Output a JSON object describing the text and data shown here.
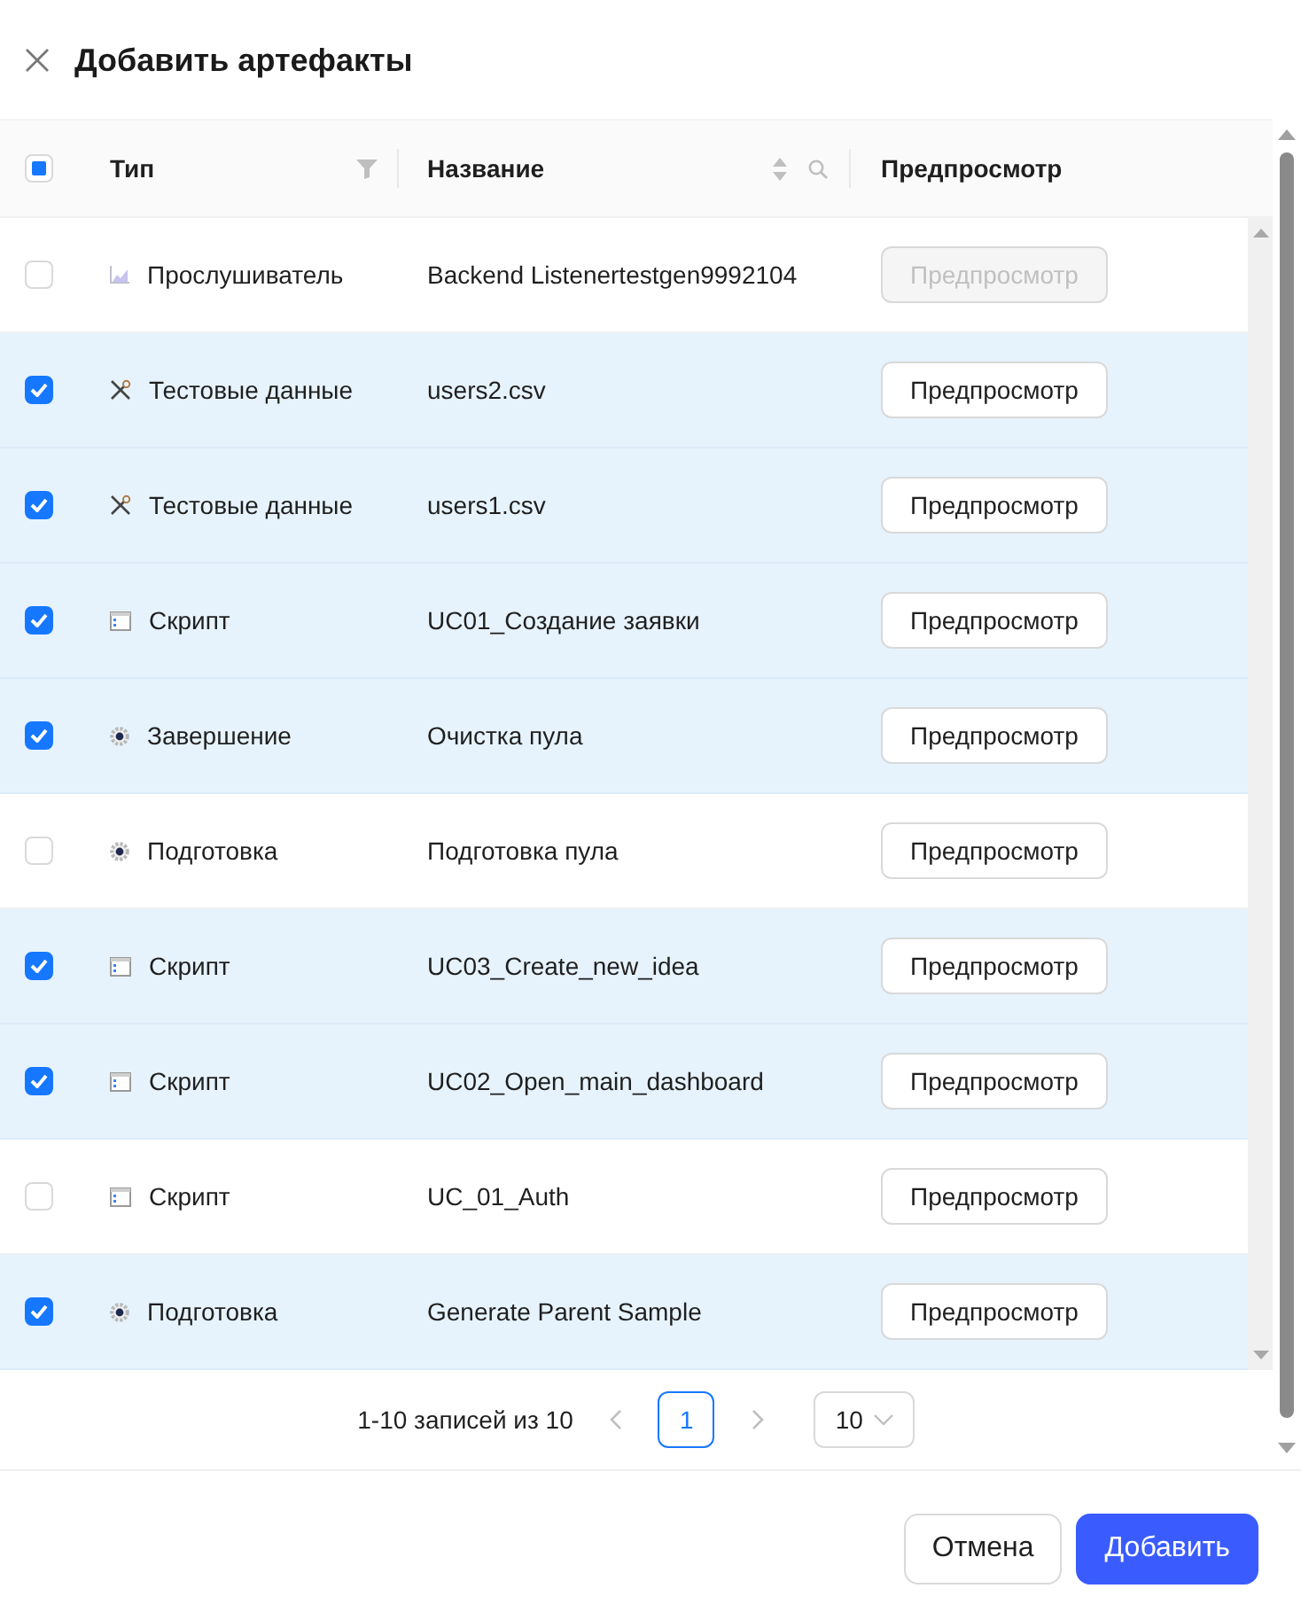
{
  "dialog": {
    "title": "Добавить артефакты"
  },
  "table": {
    "select_all": {
      "indeterminate": true
    },
    "columns": [
      {
        "label": "Тип",
        "filter": true
      },
      {
        "label": "Название",
        "sort": true,
        "search": true
      },
      {
        "label": "Предпросмотр"
      }
    ],
    "rows": [
      {
        "checked": false,
        "kind": "listener",
        "type": "Прослушиватель",
        "name": "Backend Listenertestgen9992104",
        "preview": {
          "label": "Предпросмотр",
          "disabled": true
        }
      },
      {
        "checked": true,
        "kind": "data",
        "type": "Тестовые данные",
        "name": "users2.csv",
        "preview": {
          "label": "Предпросмотр",
          "disabled": false
        }
      },
      {
        "checked": true,
        "kind": "data",
        "type": "Тестовые данные",
        "name": "users1.csv",
        "preview": {
          "label": "Предпросмотр",
          "disabled": false
        }
      },
      {
        "checked": true,
        "kind": "script",
        "type": "Скрипт",
        "name": "UC01_Создание заявки",
        "preview": {
          "label": "Предпросмотр",
          "disabled": false
        }
      },
      {
        "checked": true,
        "kind": "hook",
        "type": "Завершение",
        "name": "Очистка пула",
        "preview": {
          "label": "Предпросмотр",
          "disabled": false
        }
      },
      {
        "checked": false,
        "kind": "hook",
        "type": "Подготовка",
        "name": "Подготовка пула",
        "preview": {
          "label": "Предпросмотр",
          "disabled": false
        }
      },
      {
        "checked": true,
        "kind": "script",
        "type": "Скрипт",
        "name": "UC03_Create_new_idea",
        "preview": {
          "label": "Предпросмотр",
          "disabled": false
        }
      },
      {
        "checked": true,
        "kind": "script",
        "type": "Скрипт",
        "name": "UC02_Open_main_dashboard",
        "preview": {
          "label": "Предпросмотр",
          "disabled": false
        }
      },
      {
        "checked": false,
        "kind": "script",
        "type": "Скрипт",
        "name": "UC_01_Auth",
        "preview": {
          "label": "Предпросмотр",
          "disabled": false
        }
      },
      {
        "checked": true,
        "kind": "hook",
        "type": "Подготовка",
        "name": "Generate Parent Sample",
        "preview": {
          "label": "Предпросмотр",
          "disabled": false
        }
      }
    ]
  },
  "pagination": {
    "summary": "1-10 записей из 10",
    "pages": [
      {
        "label": "1",
        "selected": true
      }
    ],
    "page_size": "10"
  },
  "footer": {
    "buttons": [
      {
        "label": "Отмена",
        "kind": "secondary"
      },
      {
        "label": "Добавить",
        "kind": "primary"
      }
    ]
  }
}
